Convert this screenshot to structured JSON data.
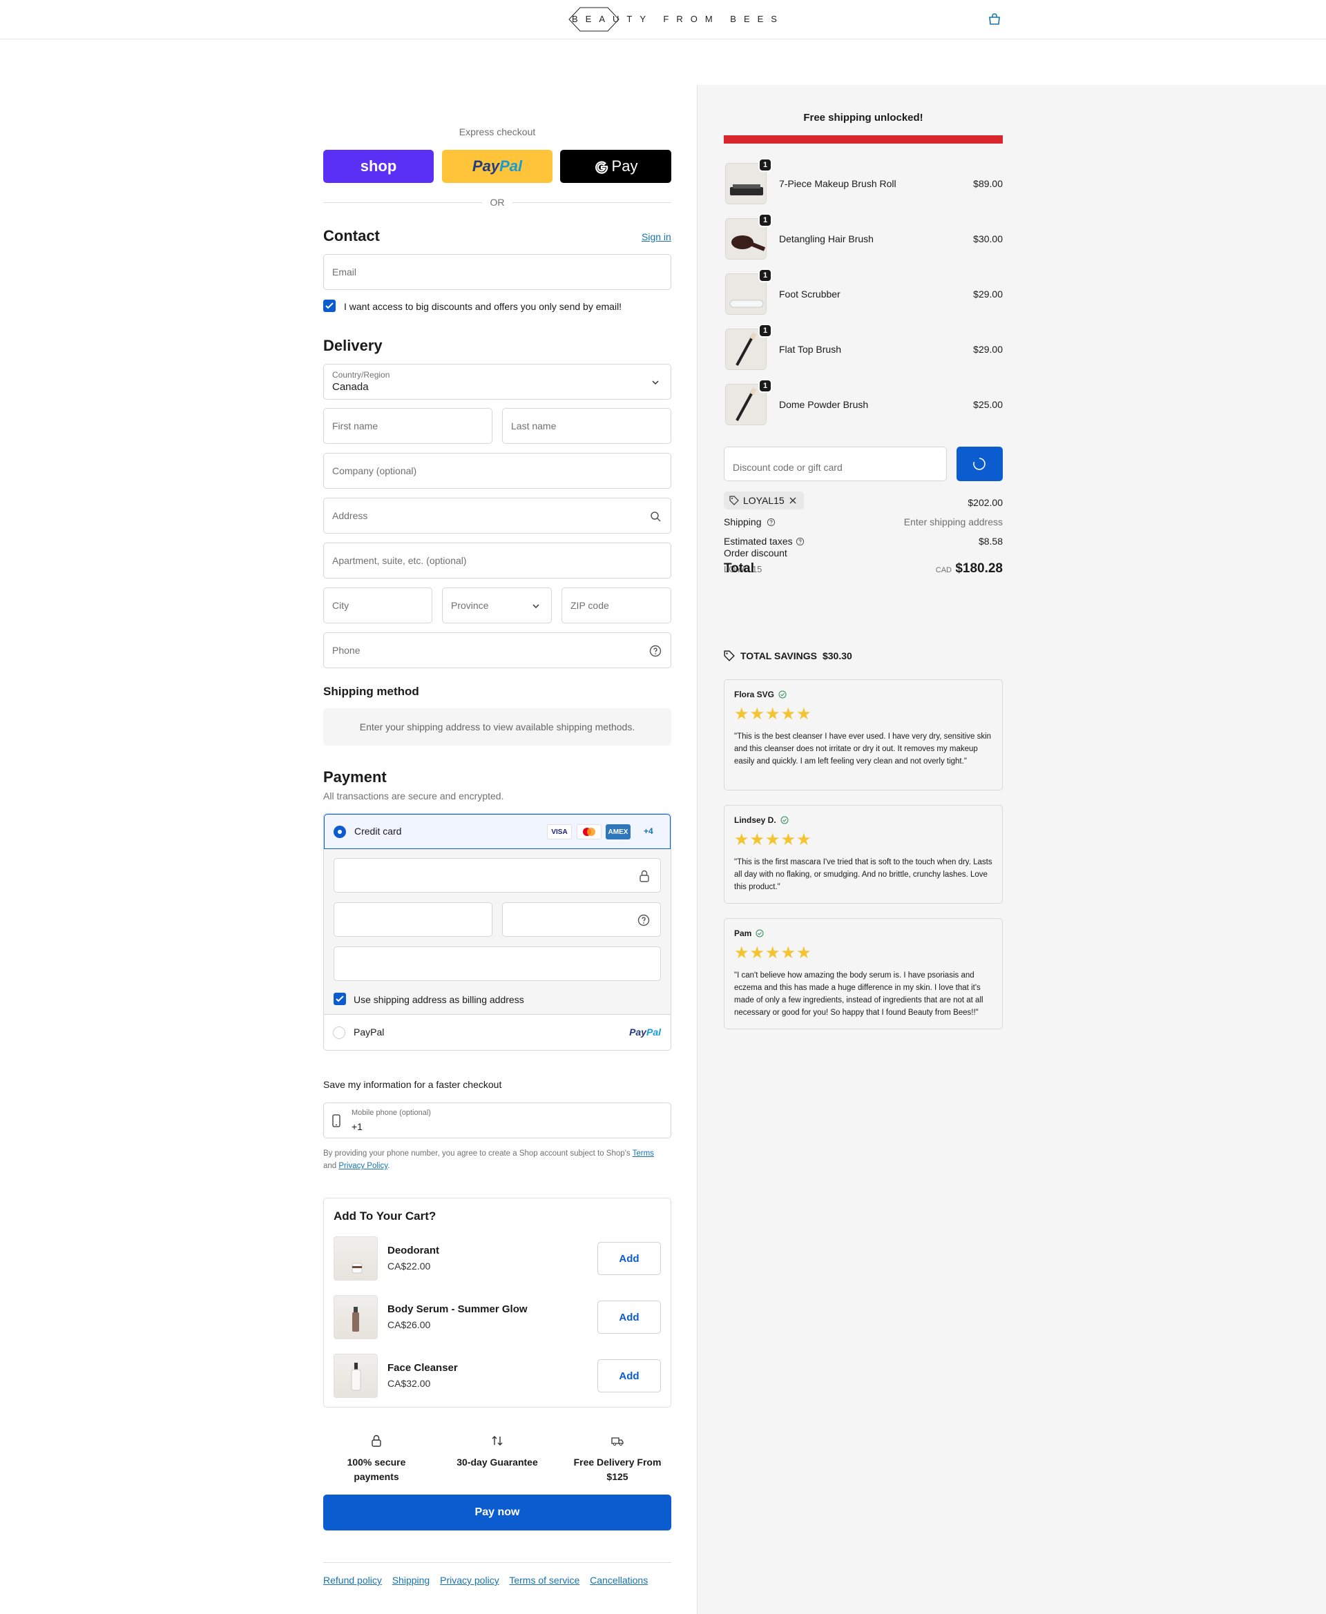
{
  "header": {
    "logo_text": "BEAUTY FROM BEES",
    "cart_icon": "bag-icon"
  },
  "express": {
    "label": "Express checkout",
    "shop_label": "shop",
    "paypal_label_1": "Pay",
    "paypal_label_2": "Pal",
    "gpay_label": "Pay",
    "or": "OR"
  },
  "contact": {
    "title": "Contact",
    "sign_in": "Sign in",
    "email_placeholder": "Email",
    "newsletter_label": "I want access to big discounts and offers you only send by email!",
    "newsletter_checked": true
  },
  "delivery": {
    "title": "Delivery",
    "country_label": "Country/Region",
    "country_value": "Canada",
    "first_name": "First name",
    "last_name": "Last name",
    "company": "Company (optional)",
    "address": "Address",
    "apartment": "Apartment, suite, etc. (optional)",
    "city": "City",
    "province": "Province",
    "zip": "ZIP code",
    "phone": "Phone"
  },
  "shipping_method": {
    "title": "Shipping method",
    "message": "Enter your shipping address to view available shipping methods."
  },
  "payment": {
    "title": "Payment",
    "subtitle": "All transactions are secure and encrypted.",
    "credit_card_label": "Credit card",
    "cards": [
      "VISA",
      "MC",
      "AMEX"
    ],
    "more_cards": "+4",
    "billing_label": "Use shipping address as billing address",
    "billing_checked": true,
    "paypal_label": "PayPal",
    "paypal_logo_1": "Pay",
    "paypal_logo_2": "Pal"
  },
  "save_info": {
    "title": "Save my information for a faster checkout",
    "mobile_label": "Mobile phone (optional)",
    "mobile_value": "+1",
    "legal_1": "By providing your phone number, you agree to create a Shop account subject to Shop's",
    "terms": "Terms",
    "legal_and": "and",
    "privacy": "Privacy Policy",
    "legal_end": "."
  },
  "upsell": {
    "title": "Add To Your Cart?",
    "add_label": "Add",
    "items": [
      {
        "name": "Deodorant",
        "price": "CA$22.00"
      },
      {
        "name": "Body Serum - Summer Glow",
        "price": "CA$26.00"
      },
      {
        "name": "Face Cleanser",
        "price": "CA$32.00"
      }
    ]
  },
  "badges": [
    {
      "line1": "100% secure",
      "line2": "payments",
      "icon": "lock-icon"
    },
    {
      "line1": "30-day Guarantee",
      "line2": "",
      "icon": "arrows-icon"
    },
    {
      "line1": "Free Delivery From",
      "line2": "$125",
      "icon": "truck-icon"
    }
  ],
  "pay_now": "Pay now",
  "footer_links": [
    "Refund policy",
    "Shipping",
    "Privacy policy",
    "Terms of service",
    "Cancellations"
  ],
  "summary": {
    "free_shipping": "Free shipping unlocked!",
    "line_items": [
      {
        "name": "7-Piece Makeup Brush Roll",
        "price": "$89.00",
        "qty": "1"
      },
      {
        "name": "Detangling Hair Brush",
        "price": "$30.00",
        "qty": "1"
      },
      {
        "name": "Foot Scrubber",
        "price": "$29.00",
        "qty": "1"
      },
      {
        "name": "Flat Top Brush",
        "price": "$29.00",
        "qty": "1"
      },
      {
        "name": "Dome Powder Brush",
        "price": "$25.00",
        "qty": "1"
      }
    ],
    "discount_placeholder": "Discount code or gift card",
    "applied_code": "LOYAL15",
    "subtotal_value": "$202.00",
    "shipping_label": "Shipping",
    "shipping_value": "Enter shipping address",
    "taxes_label": "Estimated taxes",
    "taxes_value": "$8.58",
    "order_discount_label": "Order discount",
    "order_discount_code": "LOYAL15",
    "total_label": "Total",
    "currency": "CAD",
    "total_value": "$180.28",
    "savings_label": "TOTAL SAVINGS",
    "savings_value": "$30.30"
  },
  "reviews": [
    {
      "name": "Flora SVG",
      "stars": "★★★★★",
      "text": "\"This is the best cleanser I have ever used. I have very dry, sensitive skin and this cleanser does not irritate or dry it out. It removes my makeup easily and quickly. I am left feeling very clean and not overly tight.\""
    },
    {
      "name": "Lindsey D.",
      "stars": "★★★★★",
      "text": "\"This is the first mascara I've tried that is soft to the touch when dry. Lasts all day with no flaking, or smudging. And no brittle, crunchy lashes. Love this product.\""
    },
    {
      "name": "Pam",
      "stars": "★★★★★",
      "text": "\"I can't believe how amazing the body serum is. I have psoriasis and eczema and this has made a huge difference in my skin. I love that it's made of only a few ingredients, instead of ingredients that are not at all necessary or good for you! So happy that I found Beauty from Bees!!\""
    }
  ]
}
